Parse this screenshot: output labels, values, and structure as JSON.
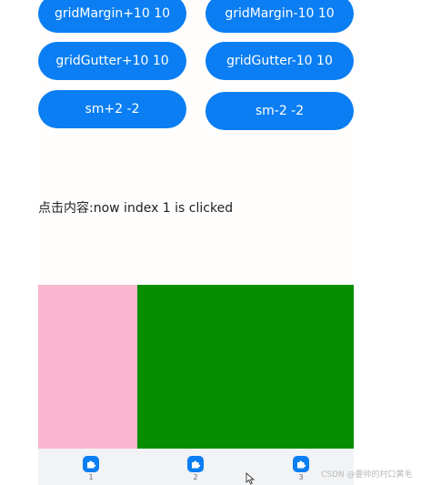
{
  "buttons": {
    "margin_plus": "gridMargin+10 10",
    "margin_minus": "gridMargin-10 10",
    "gutter_plus": "gridGutter+10 10",
    "gutter_minus": "gridGutter-10 10",
    "sm_plus": "sm+2 -2",
    "sm_minus": "sm-2 -2"
  },
  "status": {
    "text": "点击内容:now index 1 is clicked"
  },
  "panels": {
    "left_color": "#f9b7cf",
    "right_color": "#058f00"
  },
  "tabs": [
    {
      "label": "1",
      "icon": "puzzle-icon"
    },
    {
      "label": "2",
      "icon": "puzzle-icon"
    },
    {
      "label": "3",
      "icon": "puzzle-icon"
    }
  ],
  "watermark": "CSDN @要帅的村口黄毛",
  "colors": {
    "accent": "#0a7ef2",
    "tabbar_bg": "#f1f3f5"
  }
}
